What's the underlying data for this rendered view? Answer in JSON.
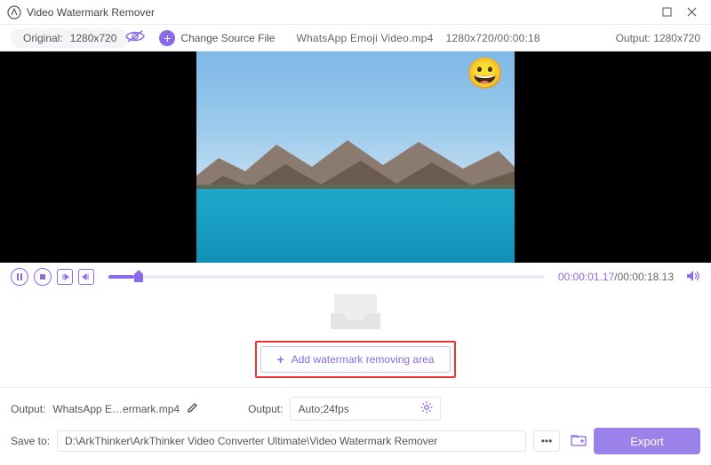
{
  "window": {
    "title": "Video Watermark Remover"
  },
  "toolbar": {
    "original_label": "Original:",
    "original_res": "1280x720",
    "change_source": "Change Source File",
    "file_name": "WhatsApp Emoji Video.mp4",
    "file_res": "1280x720",
    "file_dur": "00:00:18",
    "output_label": "Output:",
    "output_res": "1280x720"
  },
  "player": {
    "current": "00:00:01.17",
    "duration": "00:00:18.13"
  },
  "add_area_label": "Add watermark removing area",
  "bottom": {
    "output_label": "Output:",
    "output_filename": "WhatsApp E…ermark.mp4",
    "output_fmt_label": "Output:",
    "output_fmt_value": "Auto;24fps",
    "saveto_label": "Save to:",
    "saveto_path": "D:\\ArkThinker\\ArkThinker Video Converter Ultimate\\Video Watermark Remover",
    "export_label": "Export"
  }
}
